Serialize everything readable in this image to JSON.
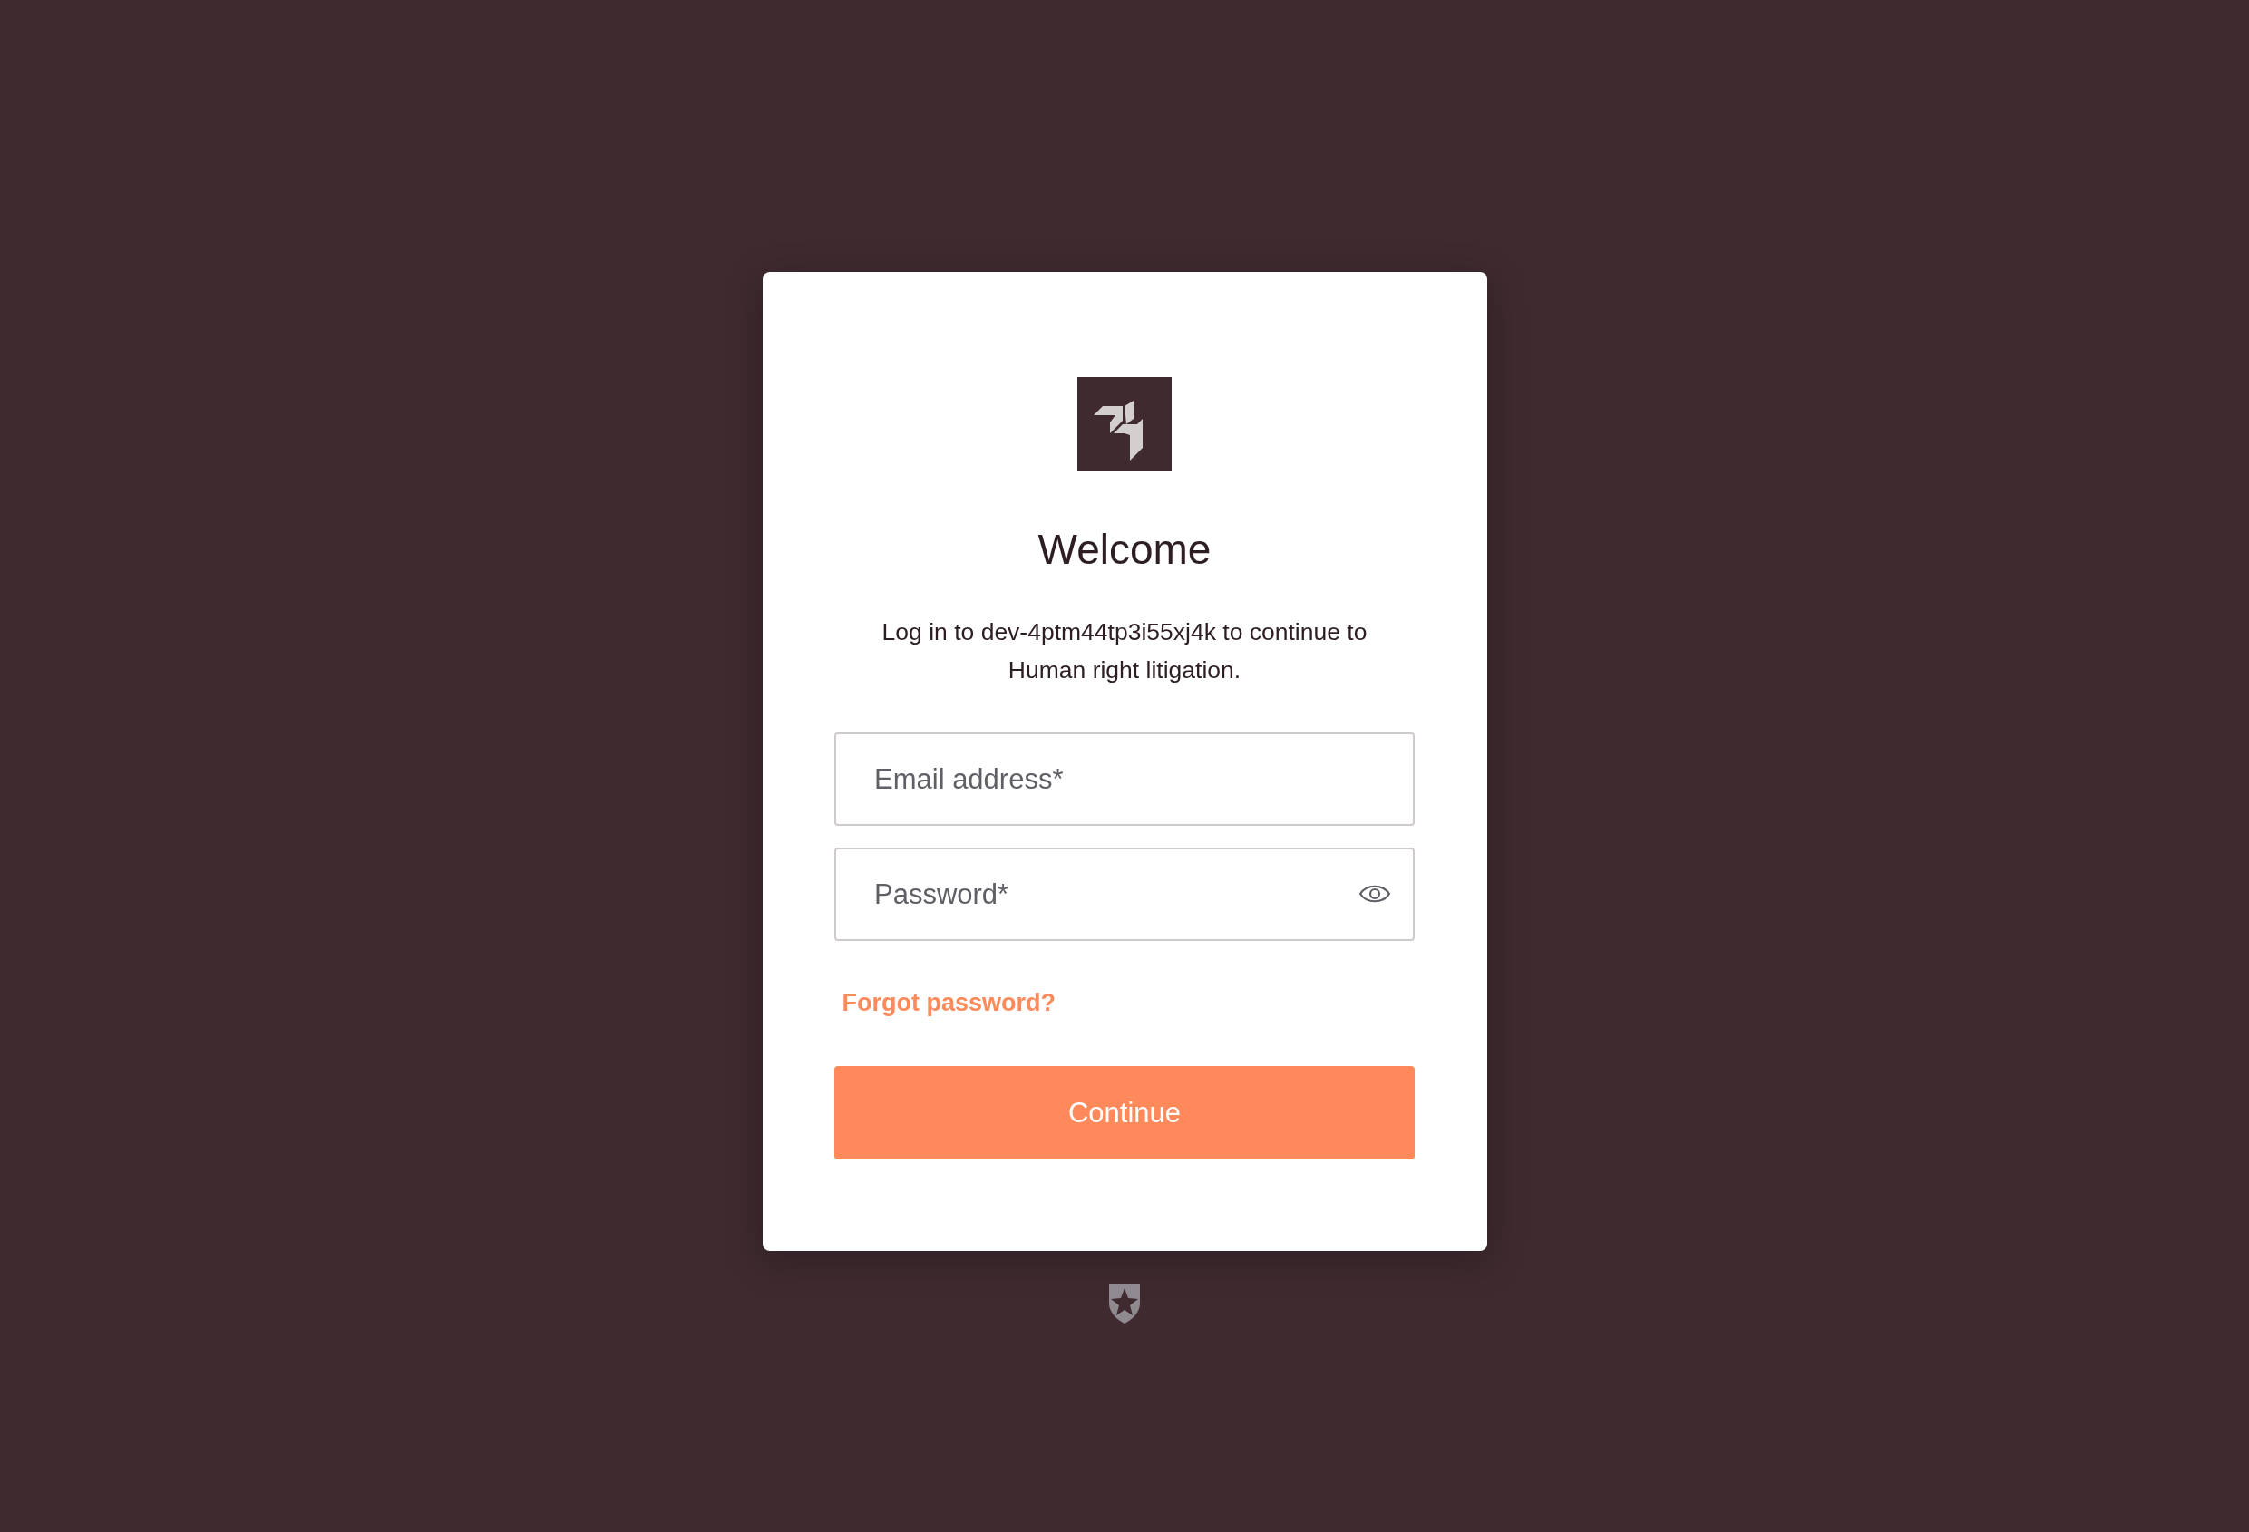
{
  "title": "Welcome",
  "subtitle": "Log in to dev-4ptm44tp3i55xj4k to continue to Human right litigation.",
  "fields": [
    {
      "kind": "text",
      "placeholder": "Email address*"
    },
    {
      "kind": "password",
      "placeholder": "Password*"
    }
  ],
  "forgot_link": "Forgot password?",
  "submit_button": "Continue"
}
